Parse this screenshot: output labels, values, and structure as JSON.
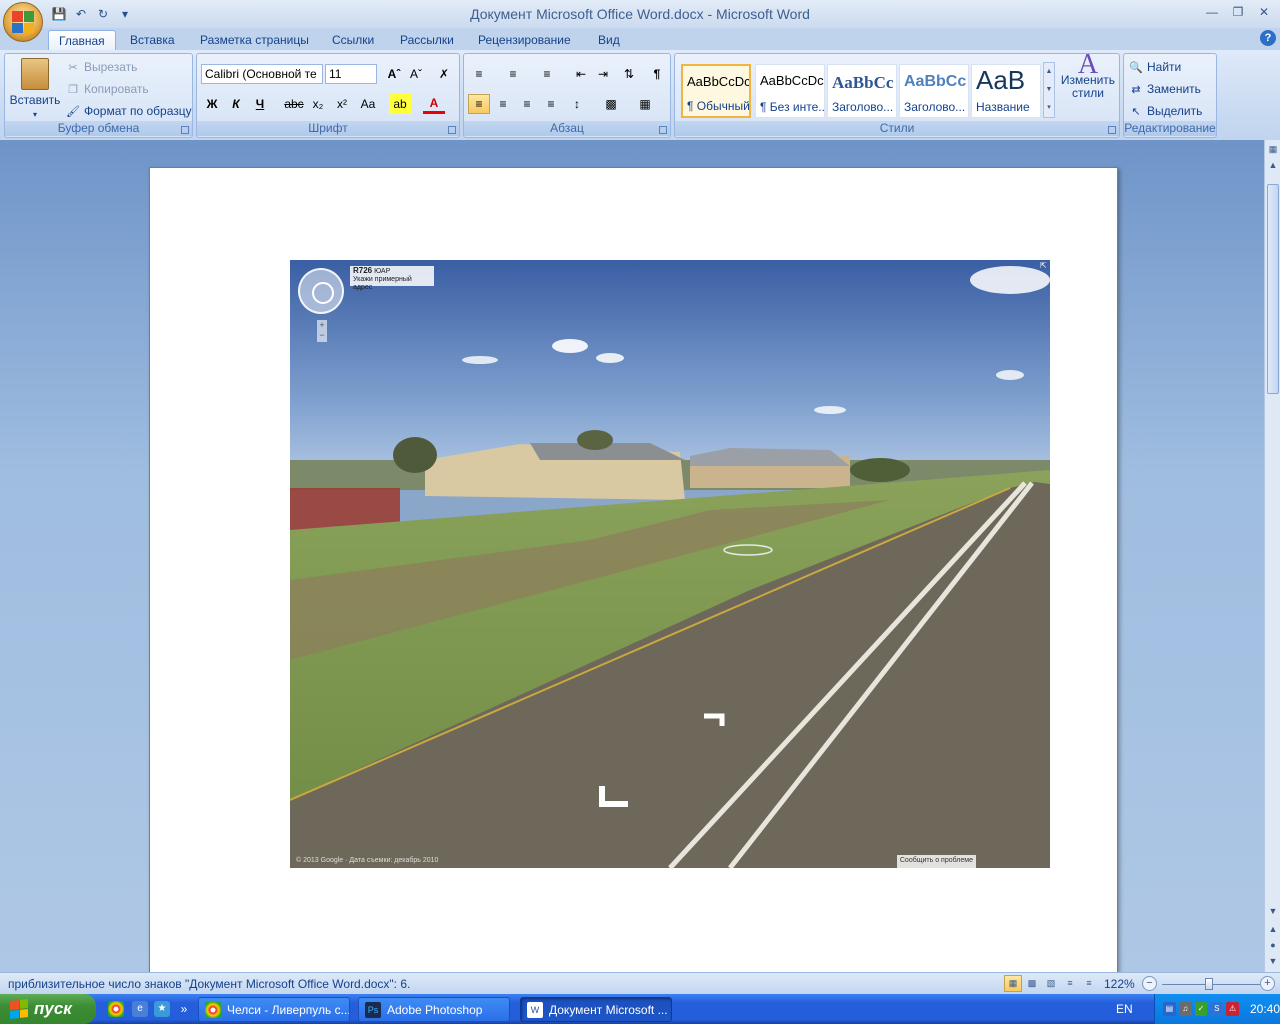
{
  "window": {
    "title": "Документ Microsoft Office Word.docx - Microsoft Word"
  },
  "tabs": [
    "Главная",
    "Вставка",
    "Разметка страницы",
    "Ссылки",
    "Рассылки",
    "Рецензирование",
    "Вид"
  ],
  "ribbon": {
    "clipboard": {
      "label": "Буфер обмена",
      "paste": "Вставить",
      "cut": "Вырезать",
      "copy": "Копировать",
      "format_painter": "Формат по образцу"
    },
    "font": {
      "label": "Шрифт",
      "font_name": "Calibri (Основной те",
      "font_size": "11"
    },
    "paragraph": {
      "label": "Абзац"
    },
    "styles": {
      "label": "Стили",
      "items": [
        {
          "sample": "AaBbCcDc",
          "name": "¶ Обычный"
        },
        {
          "sample": "AaBbCcDc",
          "name": "¶ Без инте..."
        },
        {
          "sample": "AaBbCc",
          "name": "Заголово..."
        },
        {
          "sample": "AaBbCc",
          "name": "Заголово..."
        },
        {
          "sample": "AaB",
          "name": "Название"
        }
      ],
      "change_styles": "Изменить стили"
    },
    "editing": {
      "label": "Редактирование",
      "find": "Найти",
      "replace": "Заменить",
      "select": "Выделить"
    }
  },
  "streetview": {
    "road": "R726",
    "country": "ЮАР",
    "hint": "Укажи примерный адрес",
    "copyright": "© 2013 Google · Дата съемки: декабрь 2010",
    "report": "Сообщить о проблеме"
  },
  "statusbar": {
    "text": "приблизительное число знаков \"Документ Microsoft Office Word.docx\": 6.",
    "zoom": "122%"
  },
  "taskbar": {
    "start": "пуск",
    "tasks": [
      "Челси - Ливерпуль с...",
      "Adobe Photoshop",
      "Документ Microsoft ..."
    ],
    "lang": "EN",
    "clock": "20:40"
  }
}
